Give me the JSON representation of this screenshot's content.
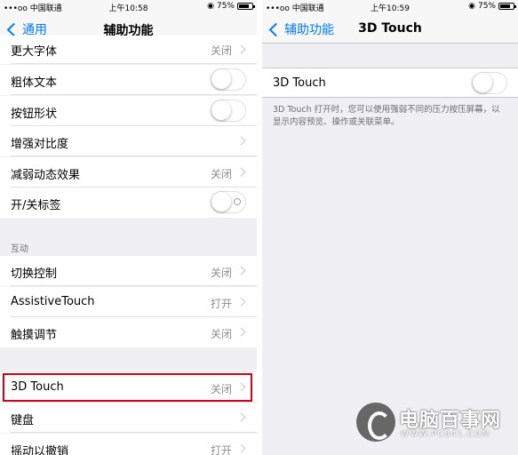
{
  "left": {
    "status": {
      "carrier": "•••oo 中国联通",
      "time": "上午10:58",
      "battery": "75%"
    },
    "nav": {
      "back": "通用",
      "title": "辅助功能"
    },
    "rows": [
      {
        "label": "更大字体",
        "value": "关闭",
        "type": "arrow"
      },
      {
        "label": "粗体文本",
        "type": "toggle"
      },
      {
        "label": "按钮形状",
        "type": "toggle"
      },
      {
        "label": "增强对比度",
        "type": "arrow"
      },
      {
        "label": "减弱动态效果",
        "value": "关闭",
        "type": "arrow"
      },
      {
        "label": "开/关标签",
        "type": "toggle"
      }
    ],
    "interaction_header": "互动",
    "interaction_rows": [
      {
        "label": "切换控制",
        "value": "关闭"
      },
      {
        "label": "AssistiveTouch",
        "value": "打开"
      },
      {
        "label": "触摸调节",
        "value": "关闭"
      }
    ],
    "bottom_rows": [
      {
        "label": "3D Touch",
        "value": "关闭"
      },
      {
        "label": "键盘",
        "value": ""
      },
      {
        "label": "摇动以撤销",
        "value": "打开"
      }
    ]
  },
  "right": {
    "status": {
      "carrier": "•••oo 中国联通",
      "time": "上午10:59",
      "battery": "75%"
    },
    "nav": {
      "back": "辅助功能",
      "title": "3D Touch"
    },
    "row_label": "3D Touch",
    "footer": "3D Touch 打开时，您可以使用强弱不同的压力按压屏幕，以显示内容预览、操作或关联菜单。"
  },
  "watermark": {
    "text": "电脑百事网",
    "url": "WWW.PC841.COM"
  },
  "colors": {
    "accent": "#007aff",
    "highlight": "#d0021b",
    "background": "#efeff4"
  }
}
